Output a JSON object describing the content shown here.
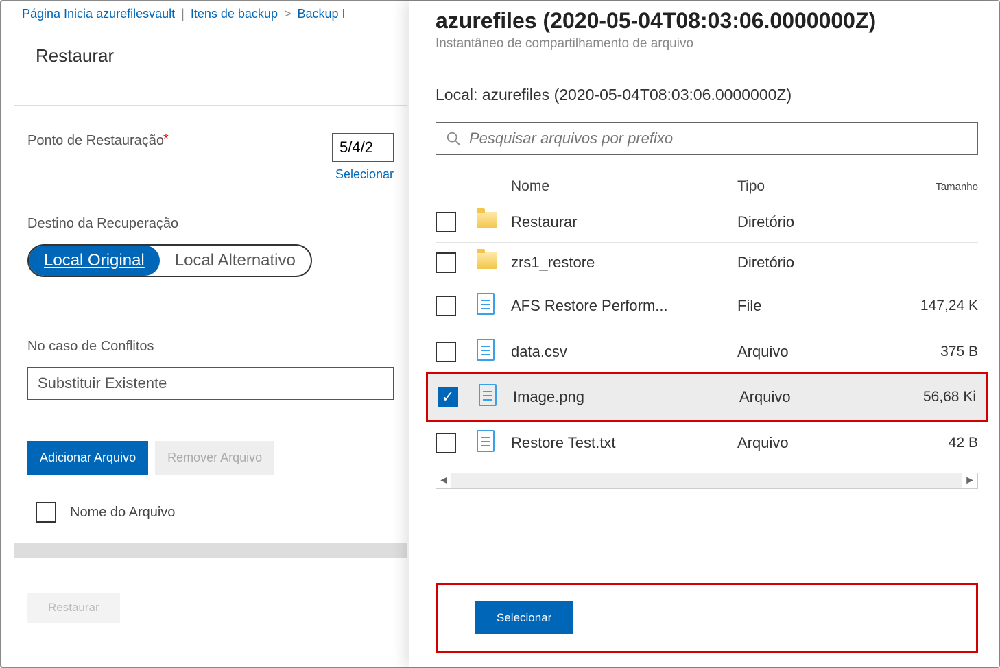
{
  "breadcrumb": {
    "home": "Página Inicia",
    "vault": "azurefilesvault",
    "items": "Itens de backup",
    "backup": "Backup I"
  },
  "left": {
    "title": "Restaurar",
    "restorePointLabel": "Ponto de Restauração",
    "dateValue": "5/4/2",
    "selectLink": "Selecionar",
    "recoveryDestLabel": "Destino da Recuperação",
    "pillOriginal": "Local Original",
    "pillAlt": "Local Alternativo",
    "conflictsLabel": "No caso de Conflitos",
    "conflictsValue": "Substituir Existente",
    "addFile": "Adicionar Arquivo",
    "removeFile": "Remover Arquivo",
    "fileNameHeader": "Nome do Arquivo",
    "restoreBtn": "Restaurar"
  },
  "blade": {
    "title": "azurefiles (2020-05-04T08:03:06.0000000Z)",
    "subtitle": "Instantâneo de compartilhamento de arquivo",
    "location": "Local: azurefiles (2020-05-04T08:03:06.0000000Z)",
    "searchPlaceholder": "Pesquisar arquivos por prefixo",
    "headers": {
      "name": "Nome",
      "type": "Tipo",
      "size": "Tamanho"
    },
    "rows": [
      {
        "icon": "folder",
        "name": "Restaurar",
        "type": "Diretório",
        "size": "",
        "checked": false,
        "highlighted": false
      },
      {
        "icon": "folder",
        "name": "zrs1_restore",
        "type": "Diretório",
        "size": "",
        "checked": false,
        "highlighted": false
      },
      {
        "icon": "file",
        "name": "AFS Restore Perform...",
        "type": "File",
        "size": "147,24 K",
        "checked": false,
        "highlighted": false
      },
      {
        "icon": "file",
        "name": "data.csv",
        "type": "Arquivo",
        "size": "375 B",
        "checked": false,
        "highlighted": false
      },
      {
        "icon": "file",
        "name": "Image.png",
        "type": "Arquivo",
        "size": "56,68 Ki",
        "checked": true,
        "highlighted": true
      },
      {
        "icon": "file",
        "name": "Restore Test.txt",
        "type": "Arquivo",
        "size": "42 B",
        "checked": false,
        "highlighted": false
      }
    ],
    "selectBtn": "Selecionar"
  }
}
